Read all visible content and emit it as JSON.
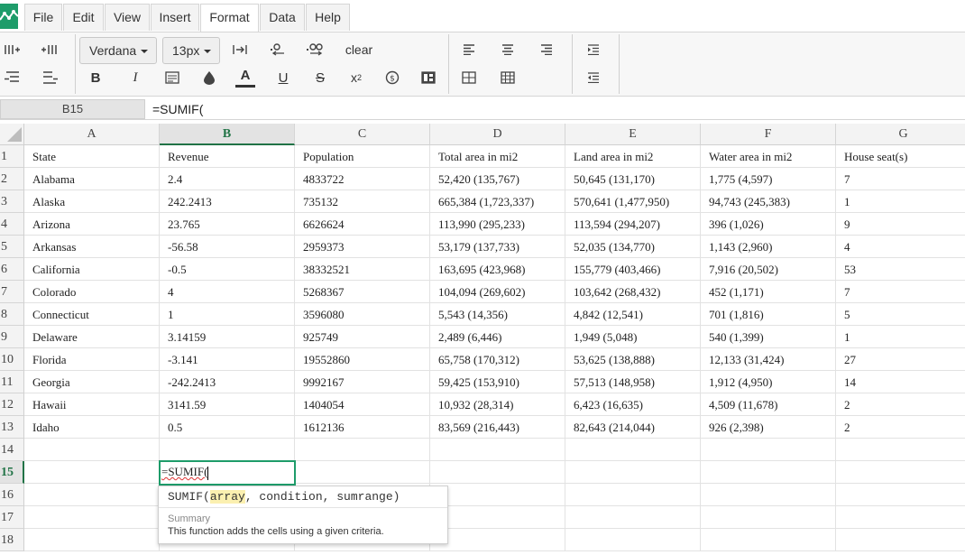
{
  "menu": [
    "File",
    "Edit",
    "View",
    "Insert",
    "Format",
    "Data",
    "Help"
  ],
  "menu_active": "Format",
  "toolbar": {
    "font_family": "Verdana",
    "font_size": "13px",
    "clear_label": "clear",
    "icons": [
      "insert-column-left-icon",
      "insert-column-right-icon",
      "indent-text-icon",
      "decrease-decimals-icon",
      "increase-decimals-icon",
      "align-left-icon",
      "align-center-icon",
      "align-right-icon",
      "increase-indent-icon",
      "insert-row-above-icon",
      "insert-row-below-icon",
      "bold-icon",
      "italic-icon",
      "wrap-text-icon",
      "fill-color-icon",
      "text-color-icon",
      "underline-icon",
      "strikethrough-icon",
      "superscript-icon",
      "currency-icon",
      "merge-cells-icon",
      "borders-icon",
      "table-grid-icon",
      "decrease-indent-icon"
    ]
  },
  "formula_bar": {
    "cell_ref": "B15",
    "value": "=SUMIF("
  },
  "columns": [
    "A",
    "B",
    "C",
    "D",
    "E",
    "F",
    "G"
  ],
  "selected_column": "B",
  "selected_row": "15",
  "rows": [
    {
      "n": "1",
      "cells": [
        "State",
        "Revenue",
        "Population",
        "Total area in mi2",
        "Land area in mi2",
        "Water area in mi2",
        "House seat(s)"
      ]
    },
    {
      "n": "2",
      "cells": [
        "Alabama",
        "2.4",
        "4833722",
        "52,420 (135,767)",
        "50,645 (131,170)",
        "1,775 (4,597)",
        "7"
      ]
    },
    {
      "n": "3",
      "cells": [
        "Alaska",
        "242.2413",
        "735132",
        "665,384 (1,723,337)",
        "570,641 (1,477,950)",
        "94,743 (245,383)",
        "1"
      ]
    },
    {
      "n": "4",
      "cells": [
        "Arizona",
        "23.765",
        "6626624",
        "113,990 (295,233)",
        "113,594 (294,207)",
        "396 (1,026)",
        "9"
      ]
    },
    {
      "n": "5",
      "cells": [
        "Arkansas",
        "-56.58",
        "2959373",
        "53,179 (137,733)",
        "52,035 (134,770)",
        "1,143 (2,960)",
        "4"
      ]
    },
    {
      "n": "6",
      "cells": [
        "California",
        "-0.5",
        "38332521",
        "163,695 (423,968)",
        "155,779 (403,466)",
        "7,916 (20,502)",
        "53"
      ]
    },
    {
      "n": "7",
      "cells": [
        "Colorado",
        "4",
        "5268367",
        "104,094 (269,602)",
        "103,642 (268,432)",
        "452 (1,171)",
        "7"
      ]
    },
    {
      "n": "8",
      "cells": [
        "Connecticut",
        "1",
        "3596080",
        "5,543 (14,356)",
        "4,842 (12,541)",
        "701 (1,816)",
        "5"
      ]
    },
    {
      "n": "9",
      "cells": [
        "Delaware",
        "3.14159",
        "925749",
        "2,489 (6,446)",
        "1,949 (5,048)",
        "540 (1,399)",
        "1"
      ]
    },
    {
      "n": "10",
      "cells": [
        "Florida",
        "-3.141",
        "19552860",
        "65,758 (170,312)",
        "53,625 (138,888)",
        "12,133 (31,424)",
        "27"
      ]
    },
    {
      "n": "11",
      "cells": [
        "Georgia",
        "-242.2413",
        "9992167",
        "59,425 (153,910)",
        "57,513 (148,958)",
        "1,912 (4,950)",
        "14"
      ]
    },
    {
      "n": "12",
      "cells": [
        "Hawaii",
        "3141.59",
        "1404054",
        "10,932 (28,314)",
        "6,423 (16,635)",
        "4,509 (11,678)",
        "2"
      ]
    },
    {
      "n": "13",
      "cells": [
        "Idaho",
        "0.5",
        "1612136",
        "83,569 (216,443)",
        "82,643 (214,044)",
        "926 (2,398)",
        "2"
      ]
    },
    {
      "n": "14",
      "cells": [
        "",
        "",
        "",
        "",
        "",
        "",
        ""
      ]
    },
    {
      "n": "15",
      "cells": [
        "",
        "",
        "",
        "",
        "",
        "",
        ""
      ]
    },
    {
      "n": "16",
      "cells": [
        "",
        "",
        "",
        "",
        "",
        "",
        ""
      ]
    },
    {
      "n": "17",
      "cells": [
        "",
        "",
        "",
        "",
        "",
        "",
        ""
      ]
    },
    {
      "n": "18",
      "cells": [
        "",
        "",
        "",
        "",
        "",
        "",
        ""
      ]
    }
  ],
  "editor": {
    "text": "=SUMIF("
  },
  "autocomplete": {
    "fn": "SUMIF(",
    "arg1": "array",
    "rest": ", condition, sumrange)",
    "title": "Summary",
    "description": "This function adds the cells using a given criteria."
  }
}
